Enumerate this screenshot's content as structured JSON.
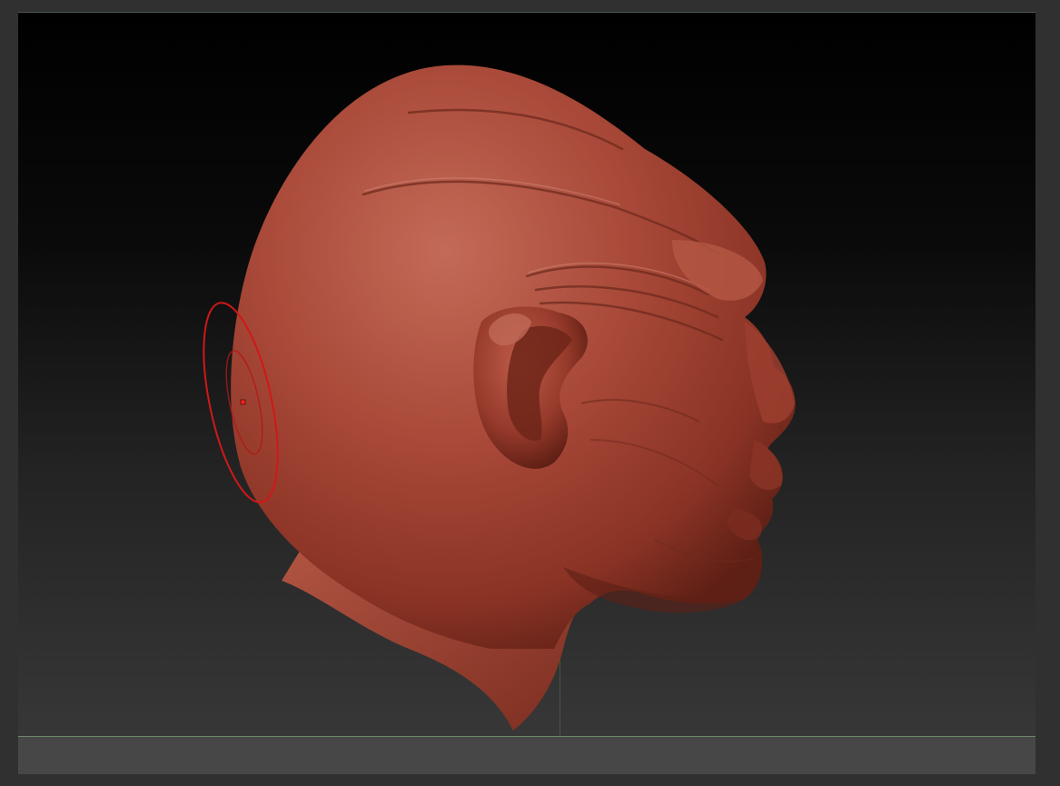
{
  "app": {
    "name": "",
    "view": "3d-viewport"
  },
  "viewport": {
    "background_top": "#000000",
    "background_bottom": "#3a3a3a",
    "floor_color": "#474747",
    "floor_line_color": "#6f8a6a",
    "model": {
      "subject": "sculpted-head-profile",
      "material_color": "#a84838"
    },
    "brush_cursor": {
      "color": "#d01818",
      "shape": "draw-size-ring"
    }
  }
}
